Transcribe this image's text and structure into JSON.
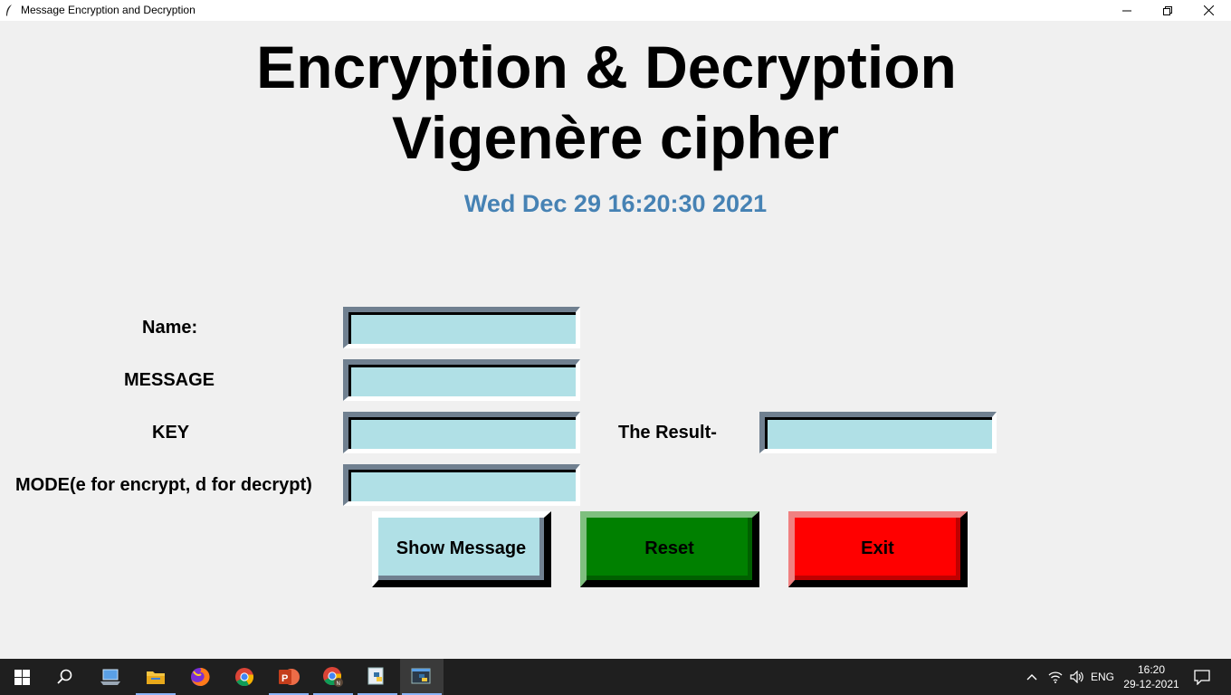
{
  "window": {
    "title": "Message Encryption and Decryption"
  },
  "header": {
    "line1": "Encryption & Decryption",
    "line2": "Vigenère cipher",
    "datetime": "Wed Dec 29 16:20:30 2021"
  },
  "form": {
    "name_label": "Name:",
    "name_value": "",
    "message_label": "MESSAGE",
    "message_value": "",
    "key_label": "KEY",
    "key_value": "",
    "mode_label": "MODE(e for encrypt, d for decrypt)",
    "mode_value": "",
    "result_label": "The Result-",
    "result_value": ""
  },
  "buttons": {
    "show": "Show Message",
    "reset": "Reset",
    "exit": "Exit"
  },
  "colors": {
    "entry_bg": "#b0e0e6",
    "datetime": "#4682b4",
    "reset_bg": "#008000",
    "exit_bg": "#ff0000"
  },
  "taskbar": {
    "apps": [
      "windows-start-icon",
      "search-icon",
      "laptop-icon",
      "file-explorer-icon",
      "firefox-icon",
      "chrome-icon",
      "powerpoint-icon",
      "chrome-profile-icon",
      "python-idle-icon",
      "python-tk-icon"
    ],
    "language": "ENG",
    "time": "16:20",
    "date": "29-12-2021"
  }
}
